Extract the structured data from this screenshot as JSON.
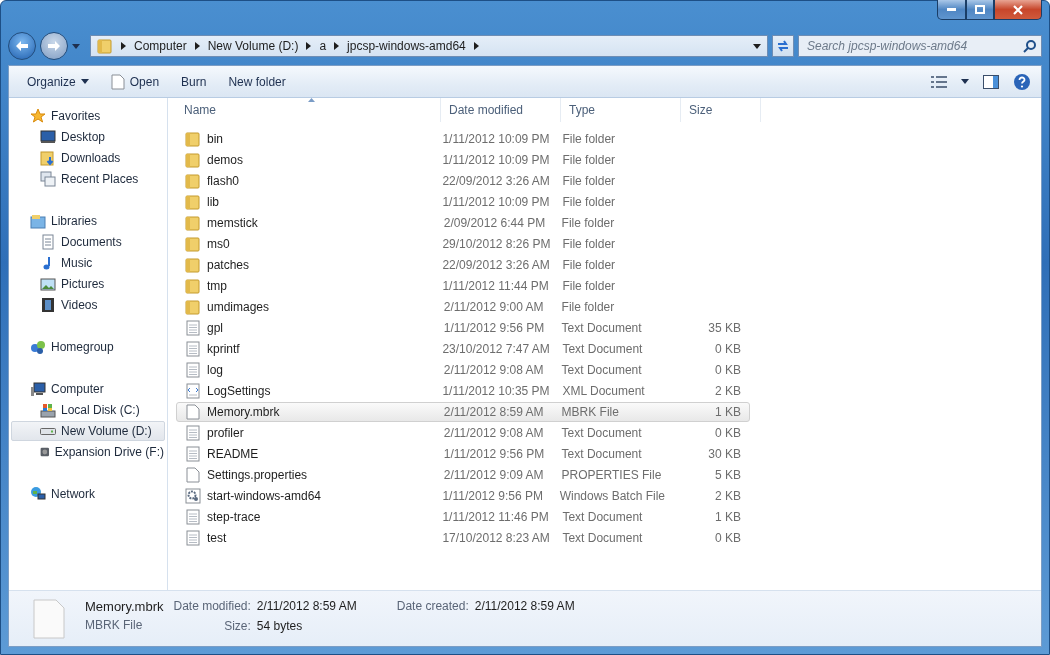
{
  "address_bar": {
    "path": [
      "Computer",
      "New Volume (D:)",
      "a",
      "jpcsp-windows-amd64"
    ]
  },
  "search": {
    "placeholder": "Search jpcsp-windows-amd64"
  },
  "toolbar": {
    "buttons": [
      {
        "label": "Organize",
        "kind": "menu"
      },
      {
        "label": "Open",
        "kind": "file"
      },
      {
        "label": "Burn",
        "kind": "plain"
      },
      {
        "label": "New folder",
        "kind": "plain"
      }
    ]
  },
  "sidebar": {
    "groups": [
      {
        "label": "Favorites",
        "kind": "star",
        "selected": false,
        "children": [
          {
            "label": "Desktop",
            "kind": "desktop",
            "selected": false
          },
          {
            "label": "Downloads",
            "kind": "downloads",
            "selected": false
          },
          {
            "label": "Recent Places",
            "kind": "recent",
            "selected": false
          }
        ]
      },
      {
        "label": "Libraries",
        "kind": "library",
        "selected": false,
        "children": [
          {
            "label": "Documents",
            "kind": "document",
            "selected": false
          },
          {
            "label": "Music",
            "kind": "music",
            "selected": false
          },
          {
            "label": "Pictures",
            "kind": "picture",
            "selected": false
          },
          {
            "label": "Videos",
            "kind": "video",
            "selected": false
          }
        ]
      },
      {
        "label": "Homegroup",
        "kind": "homegroup",
        "selected": false
      },
      {
        "label": "Computer",
        "kind": "computer",
        "selected": false,
        "children": [
          {
            "label": "Local Disk (C:)",
            "kind": "disk",
            "selected": false
          },
          {
            "label": "New Volume (D:)",
            "kind": "drive",
            "selected": true
          },
          {
            "label": "Expansion Drive (F:)",
            "kind": "external",
            "selected": false
          }
        ]
      },
      {
        "label": "Network",
        "kind": "network",
        "selected": false
      }
    ]
  },
  "table": {
    "columns": [
      {
        "label": "Name",
        "sorted": true
      },
      {
        "label": "Date modified",
        "sorted": false
      },
      {
        "label": "Type",
        "sorted": false
      },
      {
        "label": "Size",
        "sorted": false
      }
    ],
    "rows": [
      {
        "name": "bin",
        "date": "1/11/2012 10:09 PM",
        "type": "File folder",
        "kind": "folder",
        "selected": false
      },
      {
        "name": "demos",
        "date": "1/11/2012 10:09 PM",
        "type": "File folder",
        "kind": "folder",
        "selected": false
      },
      {
        "name": "flash0",
        "date": "22/09/2012 3:26 AM",
        "type": "File folder",
        "kind": "folder",
        "selected": false
      },
      {
        "name": "lib",
        "date": "1/11/2012 10:09 PM",
        "type": "File folder",
        "kind": "folder",
        "selected": false
      },
      {
        "name": "memstick",
        "date": "2/09/2012 6:44 PM",
        "type": "File folder",
        "kind": "folder",
        "selected": false
      },
      {
        "name": "ms0",
        "date": "29/10/2012 8:26 PM",
        "type": "File folder",
        "kind": "folder",
        "selected": false
      },
      {
        "name": "patches",
        "date": "22/09/2012 3:26 AM",
        "type": "File folder",
        "kind": "folder",
        "selected": false
      },
      {
        "name": "tmp",
        "date": "1/11/2012 11:44 PM",
        "type": "File folder",
        "kind": "folder",
        "selected": false
      },
      {
        "name": "umdimages",
        "date": "2/11/2012 9:00 AM",
        "type": "File folder",
        "kind": "folder",
        "selected": false
      },
      {
        "name": "gpl",
        "date": "1/11/2012 9:56 PM",
        "type": "Text Document",
        "size": "35 KB",
        "kind": "text",
        "selected": false
      },
      {
        "name": "kprintf",
        "date": "23/10/2012 7:47 AM",
        "type": "Text Document",
        "size": "0 KB",
        "kind": "text",
        "selected": false
      },
      {
        "name": "log",
        "date": "2/11/2012 9:08 AM",
        "type": "Text Document",
        "size": "0 KB",
        "kind": "text",
        "selected": false
      },
      {
        "name": "LogSettings",
        "date": "1/11/2012 10:35 PM",
        "type": "XML Document",
        "size": "2 KB",
        "kind": "xml",
        "selected": false
      },
      {
        "name": "Memory.mbrk",
        "date": "2/11/2012 8:59 AM",
        "type": "MBRK File",
        "size": "1 KB",
        "kind": "blank",
        "selected": true
      },
      {
        "name": "profiler",
        "date": "2/11/2012 9:08 AM",
        "type": "Text Document",
        "size": "0 KB",
        "kind": "text",
        "selected": false
      },
      {
        "name": "README",
        "date": "1/11/2012 9:56 PM",
        "type": "Text Document",
        "size": "30 KB",
        "kind": "text",
        "selected": false
      },
      {
        "name": "Settings.properties",
        "date": "2/11/2012 9:09 AM",
        "type": "PROPERTIES File",
        "size": "5 KB",
        "kind": "blank",
        "selected": false
      },
      {
        "name": "start-windows-amd64",
        "date": "1/11/2012 9:56 PM",
        "type": "Windows Batch File",
        "size": "2 KB",
        "kind": "batch",
        "selected": false
      },
      {
        "name": "step-trace",
        "date": "1/11/2012 11:46 PM",
        "type": "Text Document",
        "size": "1 KB",
        "kind": "text",
        "selected": false
      },
      {
        "name": "test",
        "date": "17/10/2012 8:23 AM",
        "type": "Text Document",
        "size": "0 KB",
        "kind": "text",
        "selected": false
      }
    ]
  },
  "details": {
    "name": "Memory.mbrk",
    "type": "MBRK File",
    "field_columns": [
      [
        {
          "label": "Date modified:",
          "value": "2/11/2012 8:59 AM"
        },
        {
          "label": "Size:",
          "value": "54 bytes"
        }
      ],
      [
        {
          "label": "Date created:",
          "value": "2/11/2012 8:59 AM"
        }
      ]
    ]
  }
}
